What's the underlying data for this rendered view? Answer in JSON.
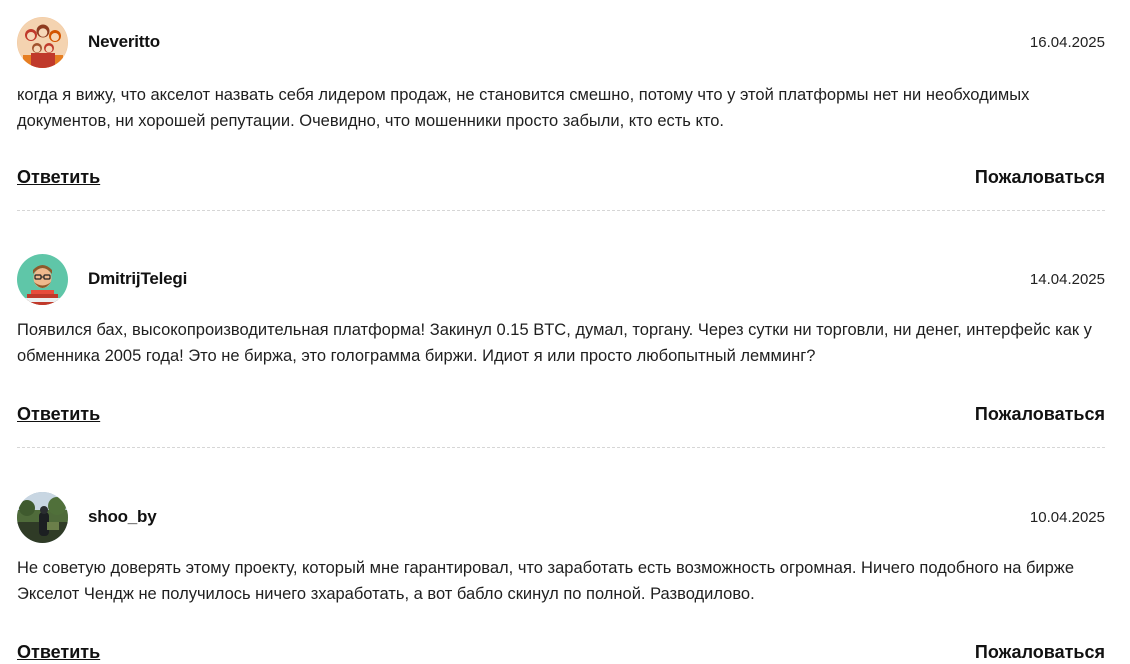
{
  "comments": [
    {
      "author": "Neveritto",
      "date": "16.04.2025",
      "text": "когда я вижу, что акселот назвать себя лидером продаж, не становится смешно, потому что у этой платформы нет ни необходимых документов, ни хорошей репутации. Очевидно, что мошенники просто забыли, кто есть кто.",
      "reply_label": "Ответить",
      "report_label": "Пожаловаться"
    },
    {
      "author": "DmitrijTelegi",
      "date": "14.04.2025",
      "text": "Появился бах, высокопроизводительная платформа! Закинул 0.15 BTC, думал, торгану. Через сутки ни торговли, ни денег, интерфейс как у обменника 2005 года! Это не биржа, это голограмма биржи. Идиот я или просто любопытный лемминг?",
      "reply_label": "Ответить",
      "report_label": "Пожаловаться"
    },
    {
      "author": "shoo_by",
      "date": "10.04.2025",
      "text": "Не советую доверять этому проекту, который мне гарантировал, что заработать есть возможность огромная. Ничего подобного на бирже Экселот Чендж не получилось ничего зхаработать, а вот бабло скинул по полной. Разводилово.",
      "reply_label": "Ответить",
      "report_label": "Пожаловаться"
    }
  ],
  "colors": {
    "text": "#1a1a1a",
    "divider": "#d6d6d6",
    "background": "#ffffff"
  },
  "icons": {
    "avatar_1": "family-photo-avatar",
    "avatar_2": "cartoon-man-avatar",
    "avatar_3": "park-photo-avatar"
  }
}
